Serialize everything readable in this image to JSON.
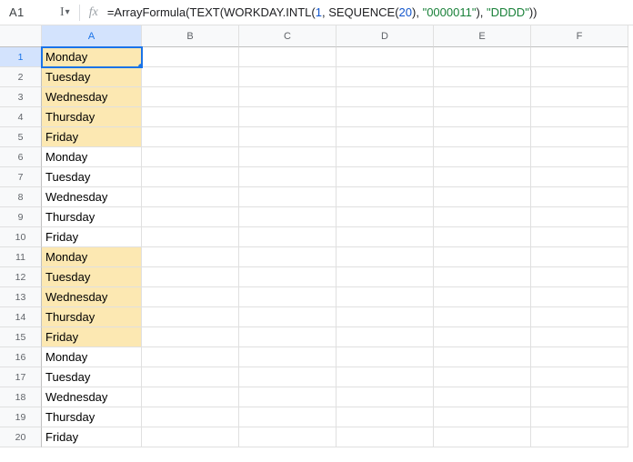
{
  "name_box": "A1",
  "formula": {
    "prefix": "=",
    "fn1": "ArrayFormula",
    "fn2": "TEXT",
    "fn3": "WORKDAY.INTL",
    "arg_num1": "1",
    "fn4": "SEQUENCE",
    "arg_num2": "20",
    "arg_str1": "\"0000011\"",
    "arg_str2": "\"DDDD\""
  },
  "columns": [
    "A",
    "B",
    "C",
    "D",
    "E",
    "F"
  ],
  "selected_column_index": 0,
  "active_row": 1,
  "rows": [
    {
      "num": 1,
      "a": "Monday",
      "hl": true,
      "active": true
    },
    {
      "num": 2,
      "a": "Tuesday",
      "hl": true
    },
    {
      "num": 3,
      "a": "Wednesday",
      "hl": true
    },
    {
      "num": 4,
      "a": "Thursday",
      "hl": true
    },
    {
      "num": 5,
      "a": "Friday",
      "hl": true
    },
    {
      "num": 6,
      "a": "Monday",
      "hl": false
    },
    {
      "num": 7,
      "a": "Tuesday",
      "hl": false
    },
    {
      "num": 8,
      "a": "Wednesday",
      "hl": false
    },
    {
      "num": 9,
      "a": "Thursday",
      "hl": false
    },
    {
      "num": 10,
      "a": "Friday",
      "hl": false
    },
    {
      "num": 11,
      "a": "Monday",
      "hl": true
    },
    {
      "num": 12,
      "a": "Tuesday",
      "hl": true
    },
    {
      "num": 13,
      "a": "Wednesday",
      "hl": true
    },
    {
      "num": 14,
      "a": "Thursday",
      "hl": true
    },
    {
      "num": 15,
      "a": "Friday",
      "hl": true
    },
    {
      "num": 16,
      "a": "Monday",
      "hl": false
    },
    {
      "num": 17,
      "a": "Tuesday",
      "hl": false
    },
    {
      "num": 18,
      "a": "Wednesday",
      "hl": false
    },
    {
      "num": 19,
      "a": "Thursday",
      "hl": false
    },
    {
      "num": 20,
      "a": "Friday",
      "hl": false
    }
  ]
}
